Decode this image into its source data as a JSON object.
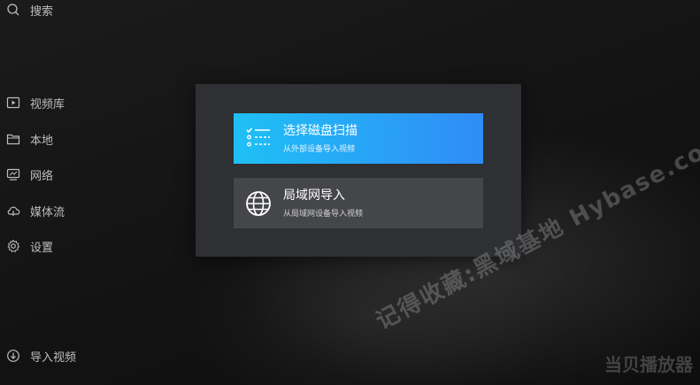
{
  "sidebar": {
    "search_label": "搜索",
    "items": [
      {
        "label": "视频库",
        "icon": "video-library-icon"
      },
      {
        "label": "本地",
        "icon": "folder-icon"
      },
      {
        "label": "网络",
        "icon": "network-icon"
      },
      {
        "label": "媒体流",
        "icon": "cloud-icon"
      },
      {
        "label": "设置",
        "icon": "gear-icon"
      }
    ],
    "import_label": "导入视频"
  },
  "dialog": {
    "options": [
      {
        "title": "选择磁盘扫描",
        "subtitle": "从外部设备导入视频",
        "icon": "checklist-icon"
      },
      {
        "title": "局域网导入",
        "subtitle": "从局域网设备导入视频",
        "icon": "globe-icon"
      }
    ]
  },
  "watermark": "记得收藏:黑域基地 Hybase.com",
  "brand": "当贝播放器",
  "colors": {
    "primary_start": "#1fc0f5",
    "primary_end": "#2f8cf7",
    "dialog_bg": "#2f3033",
    "secondary_bg": "#45464a"
  }
}
